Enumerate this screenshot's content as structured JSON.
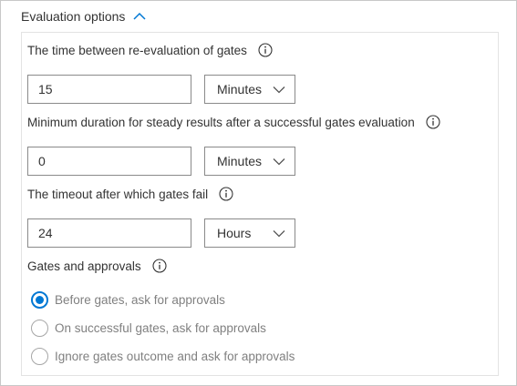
{
  "section": {
    "title": "Evaluation options"
  },
  "fields": {
    "reevaluation": {
      "label": "The time between re-evaluation of gates",
      "value": "15",
      "unit": "Minutes"
    },
    "steady_duration": {
      "label": "Minimum duration for steady results after a successful gates evaluation",
      "value": "0",
      "unit": "Minutes"
    },
    "timeout": {
      "label": "The timeout after which gates fail",
      "value": "24",
      "unit": "Hours"
    }
  },
  "approvals": {
    "label": "Gates and approvals",
    "options": [
      {
        "label": "Before gates, ask for approvals",
        "selected": true
      },
      {
        "label": "On successful gates, ask for approvals",
        "selected": false
      },
      {
        "label": "Ignore gates outcome and ask for approvals",
        "selected": false
      }
    ]
  },
  "colors": {
    "accent": "#0078d4",
    "disabled_text": "#808080"
  },
  "icons": {
    "collapse": "chevron-up-icon",
    "info": "info-icon",
    "dropdown": "chevron-down-icon"
  }
}
